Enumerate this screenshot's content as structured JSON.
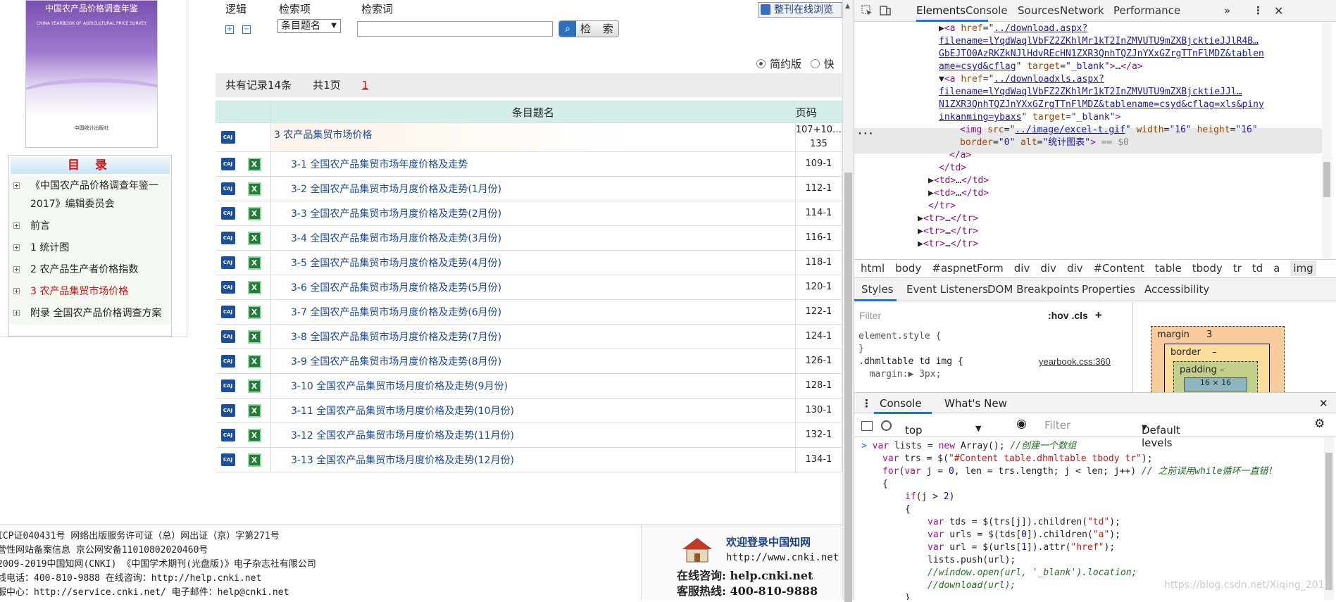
{
  "book": {
    "title": "中国农产品价格调查年鉴",
    "subtitle": "CHINA YEARBOOK OF AGRICULTURAL PRICE SURVEY",
    "publisher": "中国统计出版社"
  },
  "toc": {
    "title": "目 录",
    "items": [
      {
        "label": "《中国农产品价格调查年鉴一2017》编辑委员会",
        "active": false
      },
      {
        "label": "前言",
        "active": false
      },
      {
        "label": "1 统计图",
        "active": false
      },
      {
        "label": "2 农产品生产者价格指数",
        "active": false
      },
      {
        "label": "3 农产品集贸市场价格",
        "active": true
      },
      {
        "label": "附录 全国农产品价格调查方案",
        "active": false
      }
    ]
  },
  "search": {
    "logic_label": "逻辑",
    "field_label": "检索项",
    "keyword_label": "检索词",
    "field_value": "条目题名",
    "keyword_value": "",
    "button": "检 索",
    "online_read": "整刊在线浏览"
  },
  "view": {
    "simple": "简约版",
    "fast": "快"
  },
  "stats": {
    "records": "共有记录14条",
    "pages": "共1页",
    "current_page": "1"
  },
  "table": {
    "header_title": "条目题名",
    "header_page": "页码",
    "rows": [
      {
        "title": "3 农产品集贸市场价格",
        "pages": "107+10… 135",
        "has_xls": false,
        "indent": false
      },
      {
        "title": "3-1 全国农产品集贸市场年度价格及走势",
        "pages": "109-1",
        "has_xls": true,
        "indent": true
      },
      {
        "title": "3-2 全国农产品集贸市场月度价格及走势(1月份)",
        "pages": "112-1",
        "has_xls": true,
        "indent": true
      },
      {
        "title": "3-3 全国农产品集贸市场月度价格及走势(2月份)",
        "pages": "114-1",
        "has_xls": true,
        "indent": true
      },
      {
        "title": "3-4 全国农产品集贸市场月度价格及走势(3月份)",
        "pages": "116-1",
        "has_xls": true,
        "indent": true
      },
      {
        "title": "3-5 全国农产品集贸市场月度价格及走势(4月份)",
        "pages": "118-1",
        "has_xls": true,
        "indent": true
      },
      {
        "title": "3-6 全国农产品集贸市场月度价格及走势(5月份)",
        "pages": "120-1",
        "has_xls": true,
        "indent": true
      },
      {
        "title": "3-7 全国农产品集贸市场月度价格及走势(6月份)",
        "pages": "122-1",
        "has_xls": true,
        "indent": true
      },
      {
        "title": "3-8 全国农产品集贸市场月度价格及走势(7月份)",
        "pages": "124-1",
        "has_xls": true,
        "indent": true
      },
      {
        "title": "3-9 全国农产品集贸市场月度价格及走势(8月份)",
        "pages": "126-1",
        "has_xls": true,
        "indent": true
      },
      {
        "title": "3-10 全国农产品集贸市场月度价格及走势(9月份)",
        "pages": "128-1",
        "has_xls": true,
        "indent": true
      },
      {
        "title": "3-11 全国农产品集贸市场月度价格及走势(10月份)",
        "pages": "130-1",
        "has_xls": true,
        "indent": true
      },
      {
        "title": "3-12 全国农产品集贸市场月度价格及走势(11月份)",
        "pages": "132-1",
        "has_xls": true,
        "indent": true
      },
      {
        "title": "3-13 全国农产品集贸市场月度价格及走势(12月份)",
        "pages": "134-1",
        "has_xls": true,
        "indent": true
      }
    ]
  },
  "footer": {
    "lines": [
      "ICP证040431号 网络出版服务许可证（总）网出证（京）字第271号",
      "营性网站备案信息 京公网安备11010802020460号",
      "2009-2019中国知网(CNKI) 《中国学术期刊(光盘版)》电子杂志社有限公司",
      "线电话：400-810-9888 在线咨询：http://help.cnki.net",
      "服中心：http://service.cnki.net/ 电子邮件：help@cnki.net"
    ],
    "welcome": "欢迎登录中国知网",
    "url": "http://www.cnki.net",
    "consult": "在线咨询: help.cnki.net",
    "hotline": "客服热线: 400-810-9888"
  },
  "devtools": {
    "tabs": [
      "Elements",
      "Console",
      "Sources",
      "Network",
      "Performance"
    ],
    "more": "»",
    "breadcrumbs": [
      "html",
      "body",
      "#aspnetForm",
      "div",
      "div",
      "div",
      "#Content",
      "table",
      "tbody",
      "tr",
      "td",
      "a",
      "img"
    ],
    "sub_tabs": [
      "Styles",
      "Event Listeners",
      "DOM Breakpoints",
      "Properties",
      "Accessibility"
    ],
    "filter_placeholder": "Filter",
    "hov": ":hov",
    "cls": ".cls",
    "styles_lines": [
      "element.style {",
      "}",
      ".dhmltable td img {",
      "  margin:▶ 3px;"
    ],
    "style_src": "yearbook.css:360",
    "boxmodel": {
      "margin": "margin",
      "margin_v": "3",
      "border": "border",
      "border_v": "–",
      "padding": "padding",
      "padding_v": "–",
      "content": "16 × 16"
    },
    "drawer_tabs": [
      "Console",
      "What's New"
    ],
    "console_context": "top",
    "console_filter": "Filter",
    "levels": "Default levels",
    "el_lines": [
      {
        "i": 8,
        "html": "▶<span class='tg'>&lt;a</span> <span class='an'>href</span>=\"<span class='av'><a>../download.aspx?</a></span>"
      },
      {
        "i": 8,
        "html": "<span class='av'><a>filename=lYqdWaqlVbFZ2ZKhlMr1kT2InZMVUTU9mZXBjcktieJJlR4B…</a></span>"
      },
      {
        "i": 8,
        "html": "<span class='av'><a>GbEJTO0AzRKZkNJlHdvREcHN1ZXR3QnhTQZJnYXxGZrgTTnFlMDZ&amp;tablen</a></span>"
      },
      {
        "i": 8,
        "html": "<span class='av'><a>ame=csyd&amp;cflag</a></span>\" <span class='an'>target</span>=<span class='av'>\"_blank\"</span><span class='tg'>&gt;</span>…<span class='tg'>&lt;/a&gt;</span>"
      },
      {
        "i": 8,
        "html": "▼<span class='tg'>&lt;a</span> <span class='an'>href</span>=\"<span class='av'><a>../downloadxls.aspx?</a></span>"
      },
      {
        "i": 8,
        "html": "<span class='av'><a>filename=lYqdWaqlVbFZ2ZKhlMr1kT2InZMVUTU9mZXBjcktieJJl…</a></span>"
      },
      {
        "i": 8,
        "html": "<span class='av'><a>N1ZXR3QnhTQZJnYXxGZrgTTnFlMDZ&amp;tablename=csyd&amp;cflag=xls&amp;piny</a></span>"
      },
      {
        "i": 8,
        "html": "<span class='av'><a>inkanming=ybaxs</a></span>\" <span class='an'>target</span>=<span class='av'>\"_blank\"</span><span class='tg'>&gt;</span>"
      },
      {
        "i": 10,
        "html": "<span class='tg'>&lt;img</span> <span class='an'>src</span>=\"<span class='av'><a>../image/excel-t.gif</a></span>\" <span class='an'>width</span>=<span class='av'>\"16\"</span> <span class='an'>height</span>=<span class='av'>\"16\"</span>"
      },
      {
        "i": 10,
        "html": "<span class='an'>border</span>=<span class='av'>\"0\"</span> <span class='an'>alt</span>=<span class='av'>\"统计图表\"</span><span class='tg'>&gt;</span> <span class='gray'>== $0</span>"
      },
      {
        "i": 9,
        "html": "<span class='tg'>&lt;/a&gt;</span>"
      },
      {
        "i": 8,
        "html": "<span class='tg'>&lt;/td&gt;</span>"
      },
      {
        "i": 7,
        "html": "▶<span class='tg'>&lt;td&gt;</span>…<span class='tg'>&lt;/td&gt;</span>"
      },
      {
        "i": 7,
        "html": "▶<span class='tg'>&lt;td&gt;</span>…<span class='tg'>&lt;/td&gt;</span>"
      },
      {
        "i": 7,
        "html": "<span class='tg'>&lt;/tr&gt;</span>"
      },
      {
        "i": 6,
        "html": "▶<span class='tg'>&lt;tr&gt;</span>…<span class='tg'>&lt;/tr&gt;</span>"
      },
      {
        "i": 6,
        "html": "▶<span class='tg'>&lt;tr&gt;</span>…<span class='tg'>&lt;/tr&gt;</span>"
      },
      {
        "i": 6,
        "html": "▶<span class='tg'>&lt;tr&gt;</span>…<span class='tg'>&lt;/tr&gt;</span>"
      }
    ],
    "console_lines": [
      {
        "i": 0,
        "html": "<span style='color:#1a73e8'>&gt;</span> <span class='kw'>var</span> lists = <span class='kw'>new</span> Array();  <span class='cm'>//创建一个数组</span>"
      },
      {
        "i": 2,
        "html": "<span class='kw'>var</span> trs = $(<span class='str'>\"#Content table.dhmltable tbody tr\"</span>);"
      },
      {
        "i": 2,
        "html": "<span class='kw'>for</span>(<span class='kw'>var</span> j = <span class='num'>0</span>, len = trs.length; j &lt; len; j++) <span class='cm'>// 之前误用while循环一直错!</span>"
      },
      {
        "i": 2,
        "html": "{"
      },
      {
        "i": 6,
        "html": "<span class='kw'>if</span>(j &gt; <span class='num'>2</span>)"
      },
      {
        "i": 6,
        "html": "{"
      },
      {
        "i": 10,
        "html": "<span class='kw'>var</span> tds = $(trs[j]).children(<span class='str'>\"td\"</span>);"
      },
      {
        "i": 10,
        "html": "<span class='kw'>var</span> urls = $(tds[<span class='num'>0</span>]).children(<span class='str'>\"a\"</span>);"
      },
      {
        "i": 10,
        "html": "<span class='kw'>var</span> url = $(urls[<span class='num'>1</span>]).attr(<span class='str'>\"href\"</span>);"
      },
      {
        "i": 10,
        "html": "lists.push(url);"
      },
      {
        "i": 10,
        "html": "<span class='cm'>//window.open(url, '_blank').location;</span>"
      },
      {
        "i": 10,
        "html": "<span class='cm'>//download(url);</span>"
      },
      {
        "i": 6,
        "html": "}"
      }
    ]
  },
  "watermark": "https://blog.csdn.net/Xiqing_2016"
}
